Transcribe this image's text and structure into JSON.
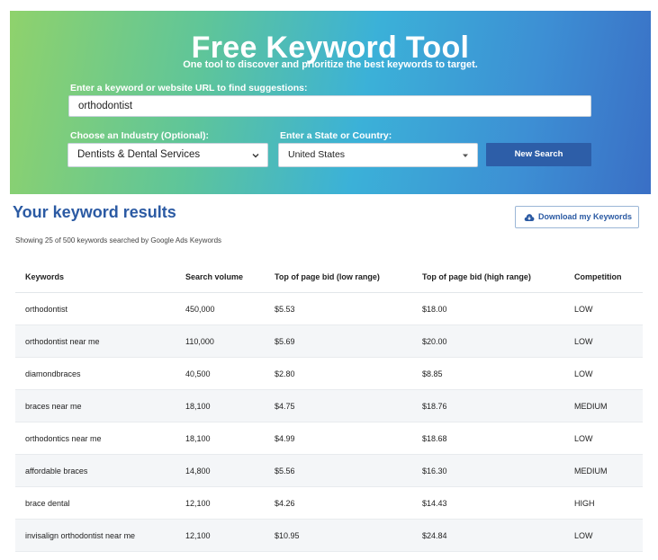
{
  "hero": {
    "title": "Free Keyword Tool",
    "subtitle": "One tool to discover and prioritize the best keywords to target.",
    "keyword_label": "Enter a keyword or website URL to find suggestions:",
    "keyword_value": "orthodontist",
    "industry_label": "Choose an Industry (Optional):",
    "industry_value": "Dentists & Dental Services",
    "location_label": "Enter a State or Country:",
    "location_value": "United States",
    "search_button": "New Search",
    "background_colors": [
      "#8fd26c",
      "#3bb1d8",
      "#3a6fc5"
    ]
  },
  "results": {
    "title": "Your keyword results",
    "subtitle": "Showing 25 of 500 keywords searched by Google Ads Keywords",
    "download_button": "Download my Keywords",
    "download_icon": "cloud-download-icon",
    "columns": [
      "Keywords",
      "Search volume",
      "Top of page bid (low range)",
      "Top of page bid (high range)",
      "Competition"
    ],
    "rows": [
      [
        "orthodontist",
        "450,000",
        "$5.53",
        "$18.00",
        "LOW"
      ],
      [
        "orthodontist near me",
        "110,000",
        "$5.69",
        "$20.00",
        "LOW"
      ],
      [
        "diamondbraces",
        "40,500",
        "$2.80",
        "$8.85",
        "LOW"
      ],
      [
        "braces near me",
        "18,100",
        "$4.75",
        "$18.76",
        "MEDIUM"
      ],
      [
        "orthodontics near me",
        "18,100",
        "$4.99",
        "$18.68",
        "LOW"
      ],
      [
        "affordable braces",
        "14,800",
        "$5.56",
        "$16.30",
        "MEDIUM"
      ],
      [
        "brace dental",
        "12,100",
        "$4.26",
        "$14.43",
        "HIGH"
      ],
      [
        "invisalign orthodontist near me",
        "12,100",
        "$10.95",
        "$24.84",
        "LOW"
      ]
    ]
  },
  "colors": {
    "accent": "#2b5aa3",
    "button": "#2d5ea8"
  }
}
